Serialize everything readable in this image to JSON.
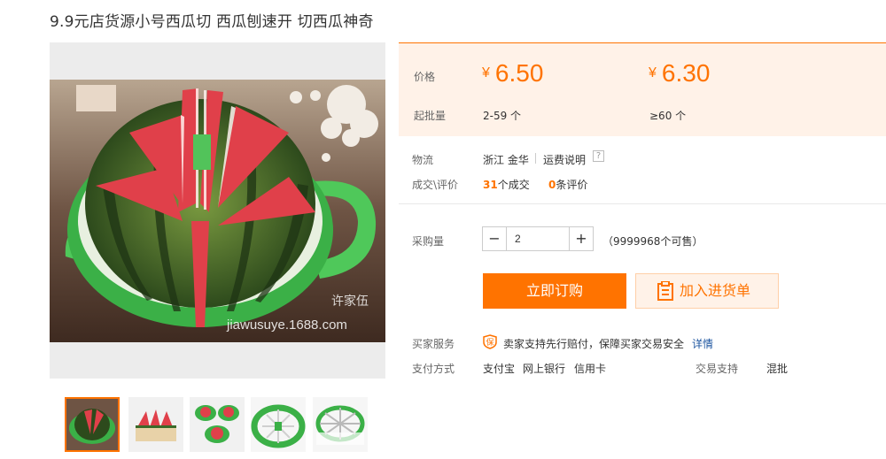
{
  "product": {
    "title": "9.9元店货源小号西瓜切 西瓜刨速开 切西瓜神奇",
    "watermark_1": "许家伍",
    "watermark_2": "jiawusuye.1688.com"
  },
  "price_panel": {
    "price_label": "价格",
    "currency": "¥",
    "tiers": [
      {
        "price": "6.50",
        "range": "2-59 个"
      },
      {
        "price": "6.30",
        "range": "≥60 个"
      }
    ],
    "min_batch_label": "起批量"
  },
  "logistics": {
    "label": "物流",
    "origin": "浙江 金华",
    "shipping_note": "运费说明",
    "help": "?"
  },
  "transactions": {
    "label": "成交\\评价",
    "deals_count": "31",
    "deals_text": "个成交",
    "reviews_count": "0",
    "reviews_text": "条评价"
  },
  "purchase": {
    "label": "采购量",
    "minus": "−",
    "plus": "+",
    "quantity": "2",
    "stock": "（9999968个可售）",
    "buy_button": "立即订购",
    "cart_button": "加入进货单"
  },
  "service": {
    "label": "买家服务",
    "shield_char": "保",
    "text": "卖家支持先行赔付，保障买家交易安全",
    "details_link": "详情"
  },
  "payment": {
    "label": "支付方式",
    "methods": [
      "支付宝",
      "网上银行",
      "信用卡"
    ],
    "trade_support_label": "交易支持",
    "trade_support_value": "混批"
  },
  "colors": {
    "accent": "#ff7300",
    "panel_bg": "#fff2e8",
    "link": "#1e56a0",
    "melon_green": "#4fc85a"
  }
}
